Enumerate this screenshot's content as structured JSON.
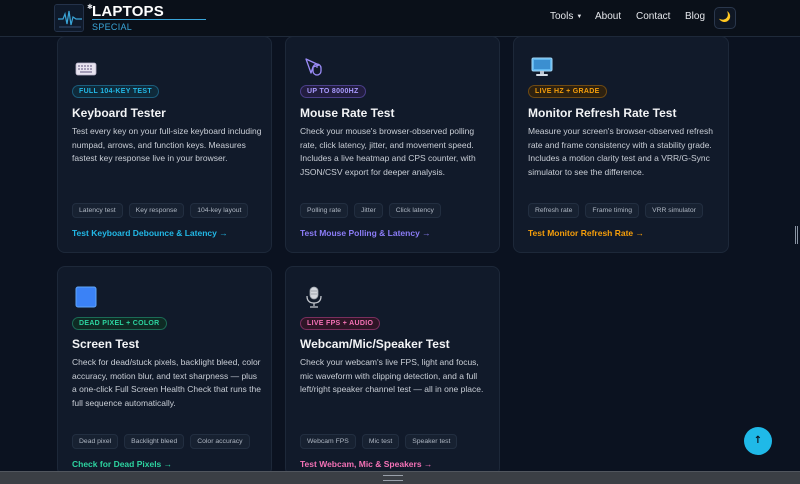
{
  "header": {
    "brand_title": "LAPTOPS",
    "brand_subtitle": "SPECIAL",
    "nav": {
      "tools": "Tools",
      "about": "About",
      "contact": "Contact",
      "blog": "Blog"
    },
    "theme_icon": "moon-icon"
  },
  "cards": [
    {
      "icon": "keyboard-icon",
      "badge": "FULL 104-KEY TEST",
      "title": "Keyboard Tester",
      "description": "Test every key on your full-size keyboard including numpad, arrows, and function keys. Measures fastest key response live in your browser.",
      "tags": [
        "Latency test",
        "Key response",
        "104-key layout"
      ],
      "link": "Test Keyboard Debounce & Latency →",
      "accent": "#22b8e6"
    },
    {
      "icon": "mouse-icon",
      "badge": "UP TO 8000HZ",
      "title": "Mouse Rate Test",
      "description": "Check your mouse's browser-observed polling rate, click latency, jitter, and movement speed. Includes a live heatmap and CPS counter, with JSON/CSV export for deeper analysis.",
      "tags": [
        "Polling rate",
        "Jitter",
        "Click latency"
      ],
      "link": "Test Mouse Polling & Latency →",
      "accent": "#8b7cf6"
    },
    {
      "icon": "monitor-icon",
      "badge": "LIVE HZ + GRADE",
      "title": "Monitor Refresh Rate Test",
      "description": "Measure your screen's browser-observed refresh rate and frame consistency with a stability grade. Includes a motion clarity test and a VRR/G-Sync simulator to see the difference.",
      "tags": [
        "Refresh rate",
        "Frame timing",
        "VRR simulator"
      ],
      "link": "Test Monitor Refresh Rate →",
      "accent": "#f59e0b"
    },
    {
      "icon": "blue-square-icon",
      "badge": "DEAD PIXEL + COLOR",
      "title": "Screen Test",
      "description": "Check for dead/stuck pixels, backlight bleed, color accuracy, motion blur, and text sharpness — plus a one-click Full Screen Health Check that runs the full sequence automatically.",
      "tags": [
        "Dead pixel",
        "Backlight bleed",
        "Color accuracy"
      ],
      "link": "Check for Dead Pixels →",
      "accent": "#2dd4a0"
    },
    {
      "icon": "microphone-icon",
      "badge": "LIVE FPS + AUDIO",
      "title": "Webcam/Mic/Speaker Test",
      "description": "Check your webcam's live FPS, light and focus, mic waveform with clipping detection, and a full left/right speaker channel test — all in one place.",
      "tags": [
        "Webcam FPS",
        "Mic test",
        "Speaker test"
      ],
      "link": "Test Webcam, Mic & Speakers →",
      "accent": "#f472b6"
    }
  ],
  "scroll_top_label": "↑"
}
